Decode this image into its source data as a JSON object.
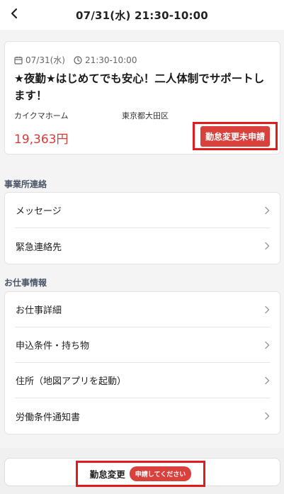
{
  "header": {
    "title": "07/31(水) 21:30-10:00"
  },
  "job": {
    "date": "07/31(水)",
    "time": "21:30-10:00",
    "title": "★夜勤★はじめてでも安心！二人体制でサポートします！",
    "company": "カイクマホーム",
    "area": "東京都大田区",
    "wage": "19,363円",
    "status": "勤怠変更未申請"
  },
  "office_section": {
    "label": "事業所連絡",
    "items": [
      {
        "label": "メッセージ"
      },
      {
        "label": "緊急連絡先"
      }
    ]
  },
  "job_section": {
    "label": "お仕事情報",
    "items": [
      {
        "label": "お仕事詳細"
      },
      {
        "label": "申込条件・持ち物"
      },
      {
        "label": "住所（地図アプリを起動）"
      },
      {
        "label": "労働条件通知書"
      }
    ]
  },
  "footer": {
    "label": "勤怠変更",
    "badge": "申請してください"
  },
  "icons": {
    "back": "chevron-left-icon",
    "calendar": "calendar-icon",
    "clock": "clock-icon",
    "row_arrow": "chevron-right-icon"
  },
  "colors": {
    "accent_red": "#d9413c",
    "highlight_red": "#e11b1b",
    "background": "#f4f4f4"
  }
}
